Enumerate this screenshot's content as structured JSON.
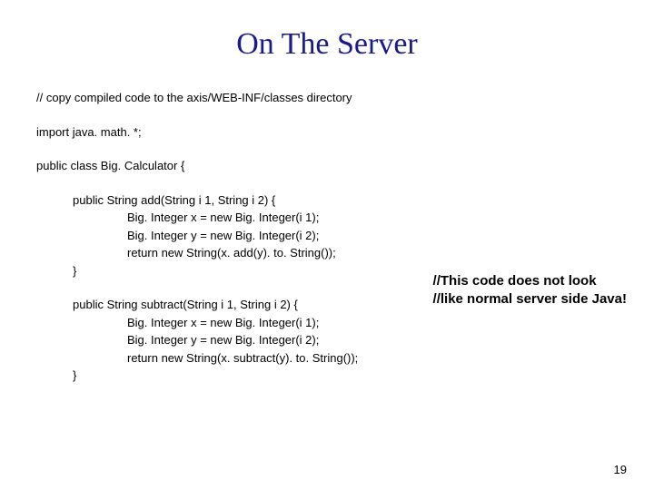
{
  "title": "On The Server",
  "code": {
    "comment": "// copy compiled code to the axis/WEB-INF/classes directory",
    "import": "import java. math. *;",
    "classDecl": "public class Big. Calculator {",
    "method1": {
      "sig": "public String add(String i 1, String i 2) {",
      "l1": "Big. Integer x = new Big. Integer(i 1);",
      "l2": "Big. Integer y = new Big. Integer(i 2);",
      "l3": "return new String(x. add(y). to. String());",
      "close": "}"
    },
    "method2": {
      "sig": "public String subtract(String i 1, String i 2) {",
      "l1": "Big. Integer x = new Big. Integer(i 1);",
      "l2": "Big. Integer y = new Big. Integer(i 2);",
      "l3": "return new String(x. subtract(y). to. String());",
      "close": "}"
    }
  },
  "annotation": {
    "l1": "//This code does not look",
    "l2": "//like normal server side Java!"
  },
  "pageNumber": "19"
}
